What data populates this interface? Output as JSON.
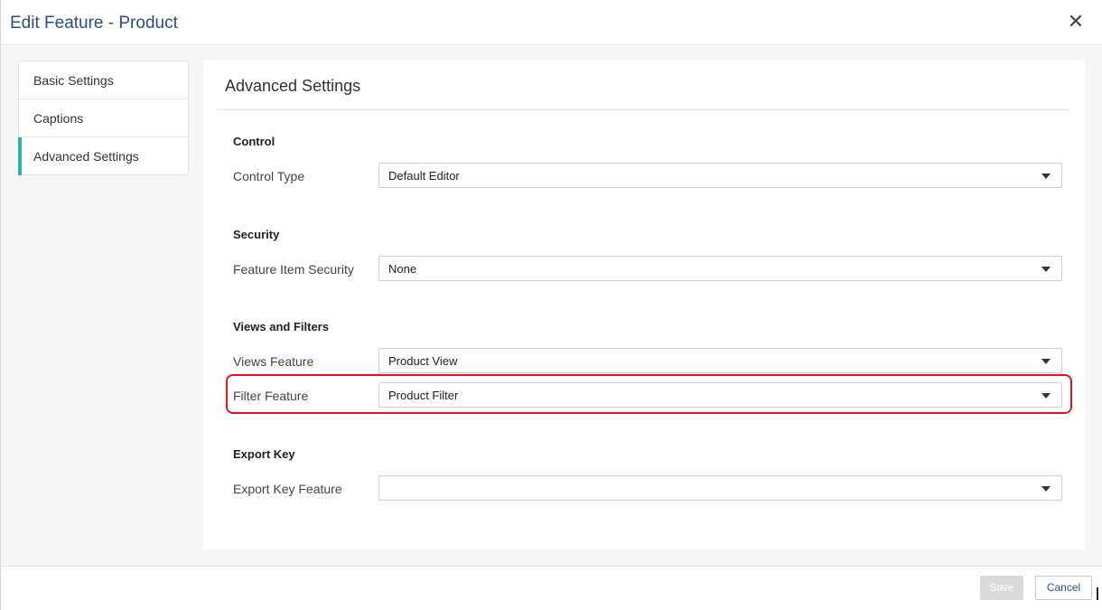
{
  "dialog": {
    "title": "Edit Feature - Product",
    "close_glyph": "✕"
  },
  "sidebar": {
    "items": [
      {
        "label": "Basic Settings",
        "active": false
      },
      {
        "label": "Captions",
        "active": false
      },
      {
        "label": "Advanced Settings",
        "active": true
      }
    ],
    "active_accent": "#2bb5a8"
  },
  "panel": {
    "title": "Advanced Settings",
    "sections": {
      "control": {
        "title": "Control",
        "control_type": {
          "label": "Control Type",
          "value": "Default Editor"
        }
      },
      "security": {
        "title": "Security",
        "feature_item_security": {
          "label": "Feature Item Security",
          "value": "None"
        }
      },
      "views_filters": {
        "title": "Views and Filters",
        "views_feature": {
          "label": "Views Feature",
          "value": "Product View"
        },
        "filter_feature": {
          "label": "Filter Feature",
          "value": "Product Filter"
        }
      },
      "export_key": {
        "title": "Export Key",
        "export_key_feature": {
          "label": "Export Key Feature",
          "value": ""
        }
      }
    },
    "highlight_color": "#e0141e"
  },
  "footer": {
    "save_label": "Save",
    "cancel_label": "Cancel"
  },
  "colors": {
    "title": "#2d4f7c",
    "panel_background": "#f5f6f7"
  }
}
